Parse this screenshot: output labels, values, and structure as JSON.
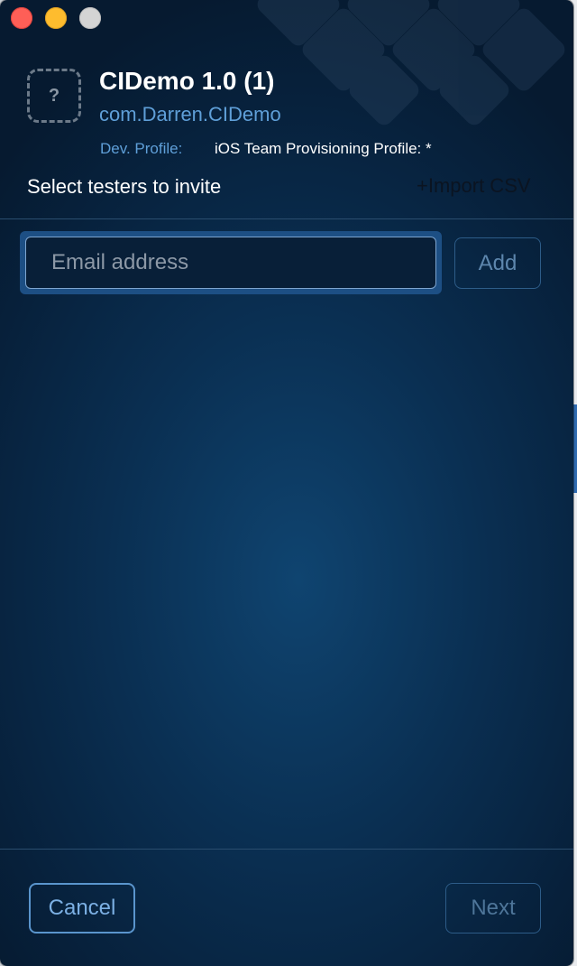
{
  "window": {
    "controls": [
      "close",
      "minimize",
      "zoom"
    ]
  },
  "app": {
    "icon": "question-mark-placeholder-icon",
    "icon_glyph": "?",
    "title": "CIDemo 1.0 (1)",
    "bundle_id": "com.Darren.CIDemo",
    "profile_label": "Dev. Profile:",
    "profile_value": "iOS Team Provisioning Profile: *"
  },
  "testers": {
    "title": "Select testers to invite",
    "import_csv": "+Import CSV",
    "email_placeholder": "Email address",
    "email_value": "",
    "add_label": "Add"
  },
  "footer": {
    "cancel_label": "Cancel",
    "next_label": "Next"
  },
  "colors": {
    "accent": "#5f9fd8",
    "background_dark": "#061a30",
    "background_center": "#0f4470"
  }
}
